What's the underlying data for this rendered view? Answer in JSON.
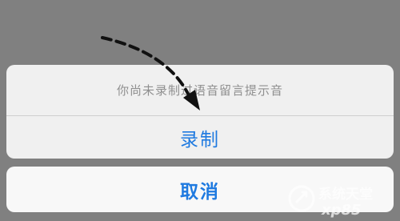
{
  "dialog": {
    "message": "你尚未录制过语音留言提示音",
    "record_label": "录制",
    "cancel_label": "取消"
  },
  "watermark": {
    "text": "系统天堂",
    "subtext": "xp85"
  },
  "colors": {
    "backdrop": "#808080",
    "sheet": "#f0f0f0",
    "action_text": "#1f7ae0",
    "message_text": "#8f8f8f"
  }
}
